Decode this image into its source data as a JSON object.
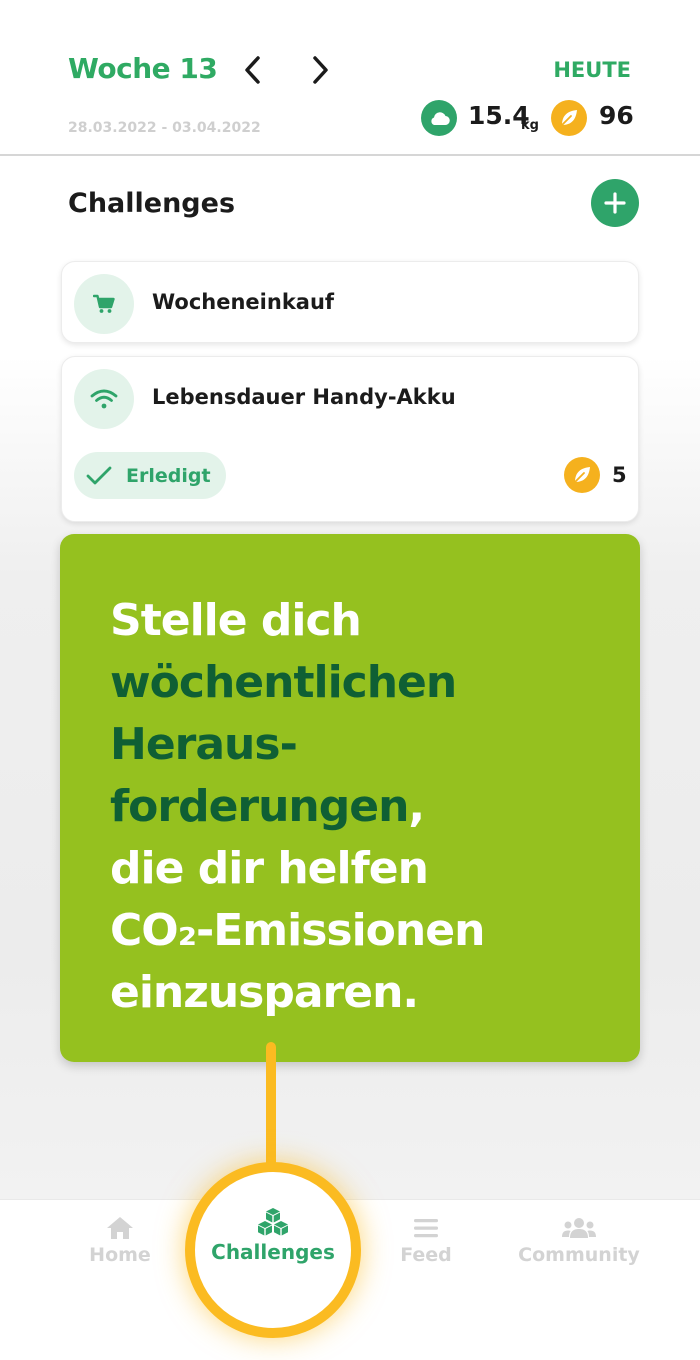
{
  "header": {
    "week_title": "Woche 13",
    "date_range": "28.03.2022 - 03.04.2022",
    "today_label": "HEUTE",
    "co2_value": "15.4",
    "co2_unit": "kg",
    "points_value": "96"
  },
  "challenges": {
    "title": "Challenges",
    "items": [
      {
        "label": "Wocheneinkauf",
        "icon": "cart-icon"
      },
      {
        "label": "Lebensdauer Handy-Akku",
        "icon": "wifi-icon",
        "status_label": "Erledigt",
        "points": "5"
      }
    ]
  },
  "promo": {
    "lines": [
      "Stelle dich",
      "wöchentlichen",
      "Heraus-",
      "forderungen",
      ",",
      "die dir helfen",
      "CO₂-Emissionen",
      "einzusparen."
    ]
  },
  "nav": {
    "home": "Home",
    "challenges": "Challenges",
    "feed": "Feed",
    "community": "Community"
  },
  "colors": {
    "brand_green": "#2fa46a",
    "promo_green": "#95c11f",
    "promo_dark": "#0f5f34",
    "accent_yellow": "#fbbb21"
  }
}
